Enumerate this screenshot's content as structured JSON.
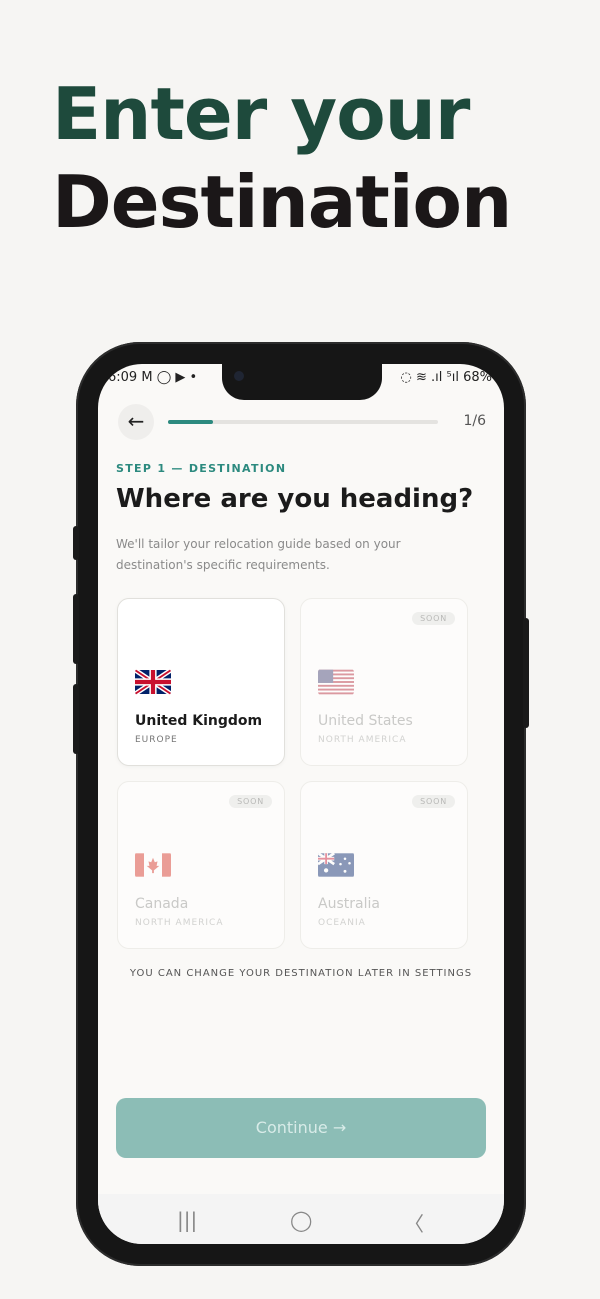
{
  "headline": {
    "line1": "Enter your",
    "line2": "Destination"
  },
  "status_bar": {
    "time": "6:09",
    "left_icons": "M ◯ ▶ •",
    "right_icons": "◌ ≋ .ıl ⁵ıl",
    "battery": "68%"
  },
  "progress": {
    "step": "1/6",
    "fraction": 0.1667
  },
  "step_label": "STEP 1 — DESTINATION",
  "title": "Where are you heading?",
  "subtitle": "We'll tailor your relocation guide based on your destination's specific requirements.",
  "destinations": [
    {
      "name": "United Kingdom",
      "region": "EUROPE",
      "selected": true,
      "badge": ""
    },
    {
      "name": "United States",
      "region": "NORTH AMERICA",
      "selected": false,
      "badge": "SOON"
    },
    {
      "name": "Canada",
      "region": "NORTH AMERICA",
      "selected": false,
      "badge": "SOON"
    },
    {
      "name": "Australia",
      "region": "OCEANIA",
      "selected": false,
      "badge": "SOON"
    }
  ],
  "footnote": "YOU CAN CHANGE YOUR DESTINATION LATER IN SETTINGS",
  "continue_label": "Continue →",
  "nav": {
    "recent": "|||",
    "home": "◯",
    "back": "〈"
  },
  "colors": {
    "accent": "#2c8a7f",
    "headline_green": "#1e4a3c",
    "continue_bg": "#8cbdb6"
  }
}
